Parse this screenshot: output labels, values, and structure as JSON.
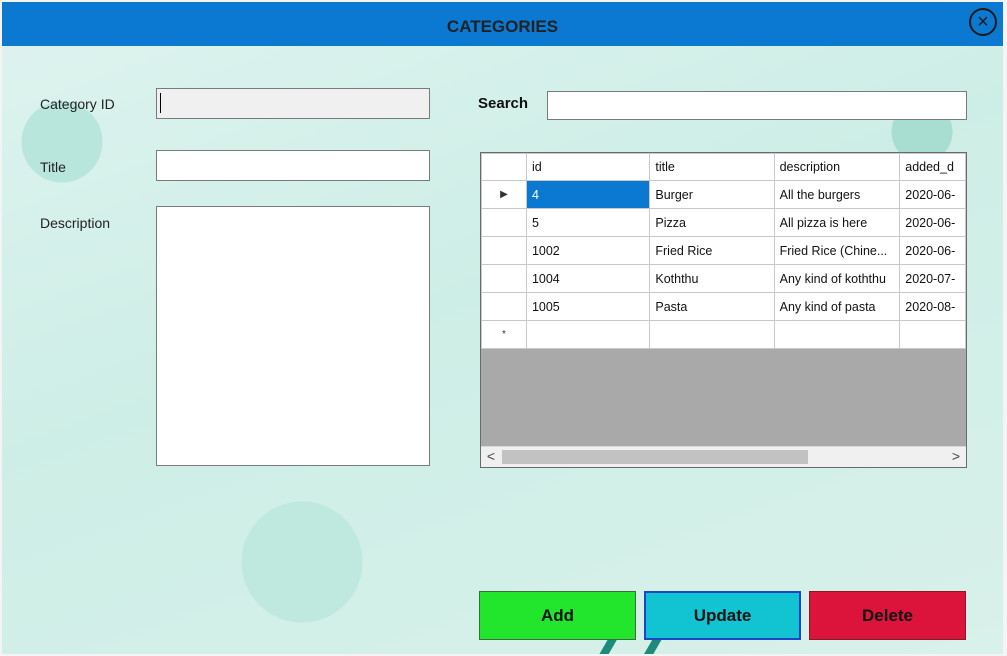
{
  "window": {
    "title": "CATEGORIES",
    "close_icon": "×"
  },
  "form": {
    "category_id_label": "Category ID",
    "category_id_value": "",
    "title_label": "Title",
    "title_value": "",
    "description_label": "Description",
    "description_value": ""
  },
  "search": {
    "label": "Search",
    "value": ""
  },
  "grid": {
    "columns": [
      "id",
      "title",
      "description",
      "added_d"
    ],
    "rows": [
      {
        "indicator": "▶",
        "id": "4",
        "title": "Burger",
        "description": "All the burgers",
        "added": "2020-06-"
      },
      {
        "indicator": "",
        "id": "5",
        "title": "Pizza",
        "description": "All pizza is here",
        "added": "2020-06-"
      },
      {
        "indicator": "",
        "id": "1002",
        "title": "Fried Rice",
        "description": "Fried Rice (Chine...",
        "added": "2020-06-"
      },
      {
        "indicator": "",
        "id": "1004",
        "title": "Koththu",
        "description": "Any kind of koththu",
        "added": "2020-07-"
      },
      {
        "indicator": "",
        "id": "1005",
        "title": "Pasta",
        "description": "Any kind of pasta",
        "added": "2020-08-"
      }
    ],
    "new_row_indicator": "*",
    "scroll_left": "<",
    "scroll_right": ">"
  },
  "buttons": {
    "add": "Add",
    "update": "Update",
    "delete": "Delete"
  },
  "colors": {
    "titlebar": "#0b78d1",
    "add": "#22e62c",
    "update": "#12c4d2",
    "delete": "#dc143c"
  }
}
